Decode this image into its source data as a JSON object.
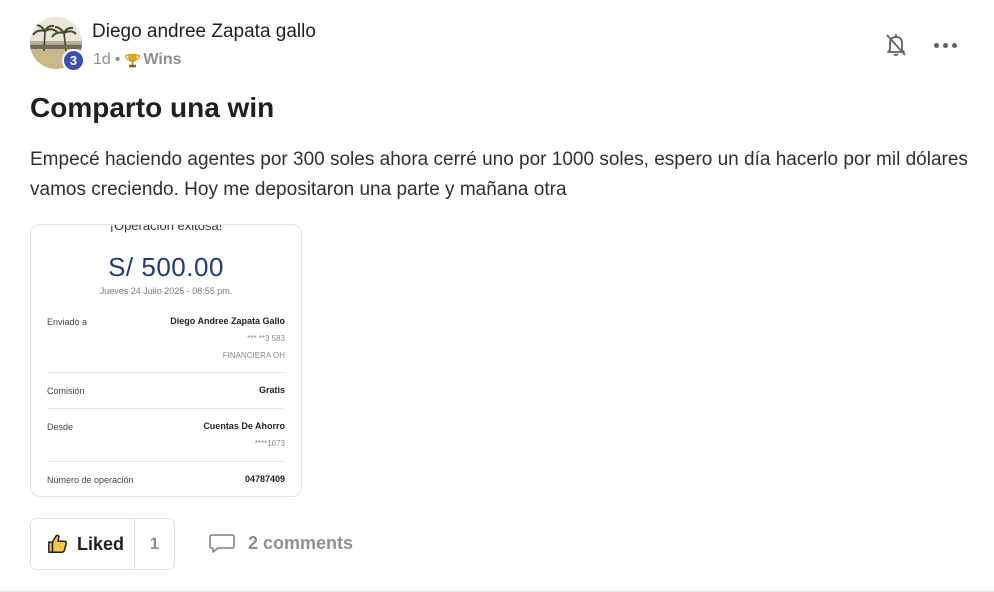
{
  "post": {
    "author": "Diego andree Zapata gallo",
    "level": "3",
    "age": "1d",
    "separator": "•",
    "category": "Wins",
    "title": "Comparto una win",
    "body": "Empecé haciendo agentes por 300 soles ahora cerré uno por 1000 soles, espero un día hacerlo por mil dólares vamos creciendo. Hoy me depositaron una parte y mañana otra"
  },
  "receipt": {
    "heading": "¡Operación exitosa!",
    "amount": "S/ 500.00",
    "date": "Jueves 24 Julio 2025 - 08:55 pm.",
    "rows": [
      {
        "label": "Enviado a",
        "value": "Diego Andree Zapata Gallo",
        "sub1": "*** **3 583",
        "sub2": "FINANCIERA OH"
      },
      {
        "label": "Comisión",
        "value": "Gratis"
      },
      {
        "label": "Desde",
        "value": "Cuentas De Ahorro",
        "sub1": "****1073"
      },
      {
        "label": "Número de operación",
        "value": "04787409"
      }
    ],
    "amount_color": "#22387c"
  },
  "actions": {
    "like_label": "Liked",
    "like_count": "1",
    "comments_label": "2 comments"
  },
  "icons": {
    "bell": "bell-off-icon",
    "more": "more-horizontal-icon",
    "like": "thumbs-up-icon",
    "comment": "comment-icon",
    "category": "trophy-icon"
  },
  "colors": {
    "level_badge": "#3b4fae",
    "muted": "#909090"
  }
}
